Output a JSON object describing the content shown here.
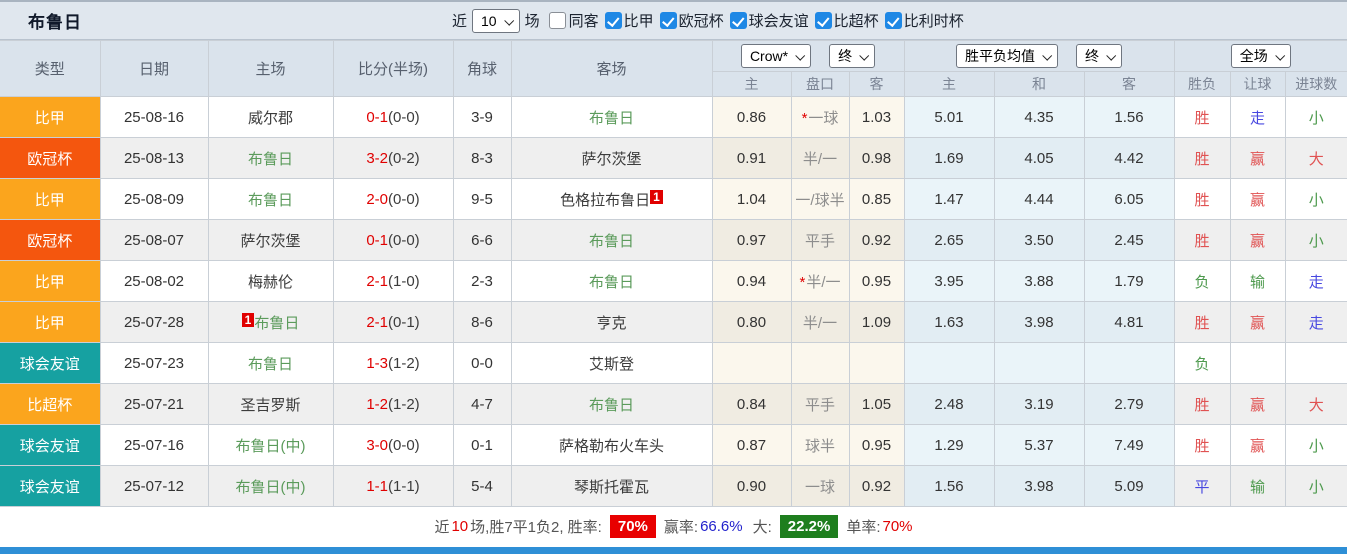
{
  "header": {
    "team": "布鲁日",
    "near_label": "近",
    "near_value": "10",
    "games_label": "场",
    "same_venue_label": "同客",
    "same_venue_checked": false,
    "filters": [
      {
        "label": "比甲",
        "checked": true
      },
      {
        "label": "欧冠杯",
        "checked": true
      },
      {
        "label": "球会友谊",
        "checked": true
      },
      {
        "label": "比超杯",
        "checked": true
      },
      {
        "label": "比利时杯",
        "checked": true
      }
    ]
  },
  "table": {
    "columns": [
      "类型",
      "日期",
      "主场",
      "比分(半场)",
      "角球",
      "客场"
    ],
    "selects": {
      "odds_source": "Crow*",
      "odds_time": "终",
      "avg_source": "胜平负均值",
      "avg_time": "终",
      "scope": "全场"
    },
    "subcolumns": [
      "主",
      "盘口",
      "客",
      "主",
      "和",
      "客",
      "胜负",
      "让球",
      "进球数"
    ],
    "rows": [
      {
        "type": "比甲",
        "color": "league",
        "date": "25-08-16",
        "home": {
          "name": "威尔郡",
          "green": false
        },
        "score": {
          "ft": "0-1",
          "ht": "(0-0)"
        },
        "corner": "3-9",
        "away": {
          "name": "布鲁日",
          "green": true
        },
        "crow": {
          "home": "0.86",
          "star": true,
          "handicap": "一球",
          "away": "1.03"
        },
        "avg": {
          "home": "5.01",
          "draw": "4.35",
          "away": "1.56"
        },
        "result": [
          [
            "胜",
            "red"
          ],
          [
            "走",
            "blue"
          ],
          [
            "小",
            "green"
          ]
        ]
      },
      {
        "type": "欧冠杯",
        "color": "ucl",
        "date": "25-08-13",
        "home": {
          "name": "布鲁日",
          "green": true
        },
        "score": {
          "ft": "3-2",
          "ht": "(0-2)"
        },
        "corner": "8-3",
        "away": {
          "name": "萨尔茨堡",
          "green": false
        },
        "crow": {
          "home": "0.91",
          "star": false,
          "handicap": "半/一",
          "away": "0.98"
        },
        "avg": {
          "home": "1.69",
          "draw": "4.05",
          "away": "4.42"
        },
        "result": [
          [
            "胜",
            "red"
          ],
          [
            "赢",
            "red"
          ],
          [
            "大",
            "red"
          ]
        ]
      },
      {
        "type": "比甲",
        "color": "league",
        "date": "25-08-09",
        "home": {
          "name": "布鲁日",
          "green": true
        },
        "score": {
          "ft": "2-0",
          "ht": "(0-0)"
        },
        "corner": "9-5",
        "away": {
          "name": "色格拉布鲁日",
          "green": false,
          "badge_after": "1"
        },
        "crow": {
          "home": "1.04",
          "star": false,
          "handicap": "一/球半",
          "away": "0.85"
        },
        "avg": {
          "home": "1.47",
          "draw": "4.44",
          "away": "6.05"
        },
        "result": [
          [
            "胜",
            "red"
          ],
          [
            "赢",
            "red"
          ],
          [
            "小",
            "green"
          ]
        ]
      },
      {
        "type": "欧冠杯",
        "color": "ucl",
        "date": "25-08-07",
        "home": {
          "name": "萨尔茨堡",
          "green": false
        },
        "score": {
          "ft": "0-1",
          "ht": "(0-0)"
        },
        "corner": "6-6",
        "away": {
          "name": "布鲁日",
          "green": true
        },
        "crow": {
          "home": "0.97",
          "star": false,
          "handicap": "平手",
          "away": "0.92"
        },
        "avg": {
          "home": "2.65",
          "draw": "3.50",
          "away": "2.45"
        },
        "result": [
          [
            "胜",
            "red"
          ],
          [
            "赢",
            "red"
          ],
          [
            "小",
            "green"
          ]
        ]
      },
      {
        "type": "比甲",
        "color": "league",
        "date": "25-08-02",
        "home": {
          "name": "梅赫伦",
          "green": false
        },
        "score": {
          "ft": "2-1",
          "ht": "(1-0)"
        },
        "corner": "2-3",
        "away": {
          "name": "布鲁日",
          "green": true
        },
        "crow": {
          "home": "0.94",
          "star": true,
          "handicap": "半/一",
          "away": "0.95"
        },
        "avg": {
          "home": "3.95",
          "draw": "3.88",
          "away": "1.79"
        },
        "result": [
          [
            "负",
            "green"
          ],
          [
            "输",
            "green"
          ],
          [
            "走",
            "blue"
          ]
        ]
      },
      {
        "type": "比甲",
        "color": "league",
        "date": "25-07-28",
        "home": {
          "name": "布鲁日",
          "green": true,
          "badge_before": "1"
        },
        "score": {
          "ft": "2-1",
          "ht": "(0-1)"
        },
        "corner": "8-6",
        "away": {
          "name": "亨克",
          "green": false
        },
        "crow": {
          "home": "0.80",
          "star": false,
          "handicap": "半/一",
          "away": "1.09"
        },
        "avg": {
          "home": "1.63",
          "draw": "3.98",
          "away": "4.81"
        },
        "result": [
          [
            "胜",
            "red"
          ],
          [
            "赢",
            "red"
          ],
          [
            "走",
            "blue"
          ]
        ]
      },
      {
        "type": "球会友谊",
        "color": "friendly",
        "date": "25-07-23",
        "home": {
          "name": "布鲁日",
          "green": true
        },
        "score": {
          "ft": "1-3",
          "ht": "(1-2)"
        },
        "corner": "0-0",
        "away": {
          "name": "艾斯登",
          "green": false
        },
        "crow": {
          "home": "",
          "star": false,
          "handicap": "",
          "away": ""
        },
        "avg": {
          "home": "",
          "draw": "",
          "away": ""
        },
        "result": [
          [
            "负",
            "green"
          ],
          [
            "",
            ""
          ],
          [
            "",
            ""
          ]
        ]
      },
      {
        "type": "比超杯",
        "color": "league",
        "date": "25-07-21",
        "home": {
          "name": "圣吉罗斯",
          "green": false
        },
        "score": {
          "ft": "1-2",
          "ht": "(1-2)"
        },
        "corner": "4-7",
        "away": {
          "name": "布鲁日",
          "green": true
        },
        "crow": {
          "home": "0.84",
          "star": false,
          "handicap": "平手",
          "away": "1.05"
        },
        "avg": {
          "home": "2.48",
          "draw": "3.19",
          "away": "2.79"
        },
        "result": [
          [
            "胜",
            "red"
          ],
          [
            "赢",
            "red"
          ],
          [
            "大",
            "red"
          ]
        ]
      },
      {
        "type": "球会友谊",
        "color": "friendly",
        "date": "25-07-16",
        "home": {
          "name": "布鲁日(中)",
          "green": true
        },
        "score": {
          "ft": "3-0",
          "ht": "(0-0)"
        },
        "corner": "0-1",
        "away": {
          "name": "萨格勒布火车头",
          "green": false
        },
        "crow": {
          "home": "0.87",
          "star": false,
          "handicap": "球半",
          "away": "0.95"
        },
        "avg": {
          "home": "1.29",
          "draw": "5.37",
          "away": "7.49"
        },
        "result": [
          [
            "胜",
            "red"
          ],
          [
            "赢",
            "red"
          ],
          [
            "小",
            "green"
          ]
        ]
      },
      {
        "type": "球会友谊",
        "color": "friendly",
        "date": "25-07-12",
        "home": {
          "name": "布鲁日(中)",
          "green": true
        },
        "score": {
          "ft": "1-1",
          "ht": "(1-1)"
        },
        "corner": "5-4",
        "away": {
          "name": "琴斯托霍瓦",
          "green": false
        },
        "crow": {
          "home": "0.90",
          "star": false,
          "handicap": "一球",
          "away": "0.92"
        },
        "avg": {
          "home": "1.56",
          "draw": "3.98",
          "away": "5.09"
        },
        "result": [
          [
            "平",
            "blue"
          ],
          [
            "输",
            "green"
          ],
          [
            "小",
            "green"
          ]
        ]
      }
    ]
  },
  "summary": {
    "prefix": "近",
    "count": "10",
    "mid": "场,胜7平1负2, 胜率:",
    "win_rate_badge": "70%",
    "win_label": "赢率:",
    "win_value": "66.6%",
    "big_label": "大:",
    "big_badge": "22.2%",
    "single_label": "单率:",
    "single_value": "70%"
  },
  "colors": {
    "league": "#FBA51D",
    "ucl": "#F4560E",
    "friendly": "#16A1A1",
    "score_red": "#E00000",
    "team_green": "#5B9B5B",
    "res_red": "#E05252",
    "res_blue": "#4848E0",
    "res_green": "#4E9A4E",
    "badge_red": "#E80000",
    "badge_green": "#1E7E1E",
    "link_blue": "#2222CC",
    "bottom_bar": "#2E8FD6",
    "checkbox_blue": "#1E88E5"
  }
}
